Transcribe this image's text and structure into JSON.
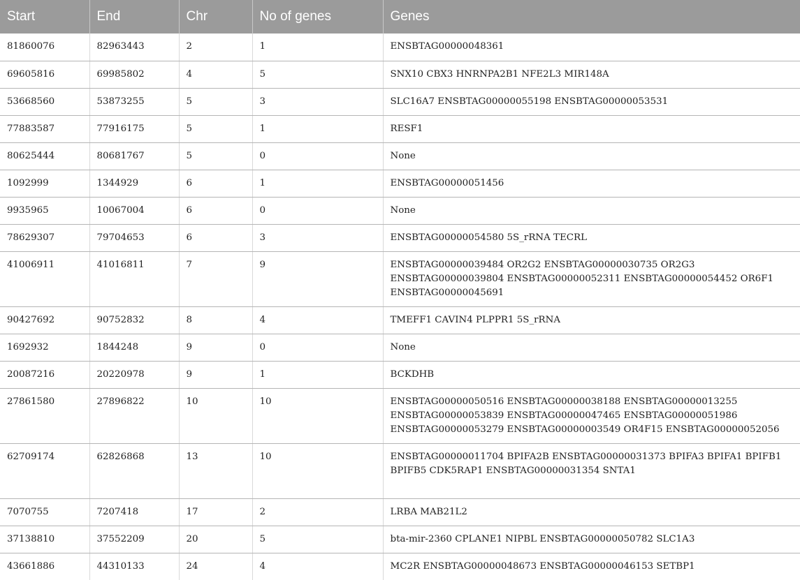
{
  "headers": [
    "Start",
    "End",
    "Chr",
    "No of genes",
    "Genes"
  ],
  "rows": [
    {
      "start": "81860076",
      "end": "82963443",
      "chr": "2",
      "count": "1",
      "genes": "ENSBTAG00000048361"
    },
    {
      "start": "69605816",
      "end": "69985802",
      "chr": "4",
      "count": "5",
      "genes": "SNX10 CBX3 HNRNPA2B1 NFE2L3 MIR148A"
    },
    {
      "start": "53668560",
      "end": "53873255",
      "chr": "5",
      "count": "3",
      "genes": "SLC16A7 ENSBTAG00000055198 ENSBTAG00000053531"
    },
    {
      "start": "77883587",
      "end": "77916175",
      "chr": "5",
      "count": "1",
      "genes": "RESF1"
    },
    {
      "start": "80625444",
      "end": "80681767",
      "chr": "5",
      "count": "0",
      "genes": "None"
    },
    {
      "start": "1092999",
      "end": "1344929",
      "chr": "6",
      "count": "1",
      "genes": "ENSBTAG00000051456"
    },
    {
      "start": "9935965",
      "end": "10067004",
      "chr": "6",
      "count": "0",
      "genes": "None"
    },
    {
      "start": "78629307",
      "end": "79704653",
      "chr": "6",
      "count": "3",
      "genes": "ENSBTAG00000054580 5S_rRNA TECRL"
    },
    {
      "start": "41006911",
      "end": "41016811",
      "chr": "7",
      "count": "9",
      "genes": "ENSBTAG00000039484 OR2G2 ENSBTAG00000030735 OR2G3 ENSBTAG00000039804 ENSBTAG00000052311 ENSBTAG00000054452 OR6F1 ENSBTAG00000045691"
    },
    {
      "start": "90427692",
      "end": "90752832",
      "chr": "8",
      "count": "4",
      "genes": "TMEFF1 CAVIN4 PLPPR1 5S_rRNA"
    },
    {
      "start": "1692932",
      "end": "1844248",
      "chr": "9",
      "count": "0",
      "genes": "None"
    },
    {
      "start": "20087216",
      "end": "20220978",
      "chr": "9",
      "count": "1",
      "genes": "BCKDHB"
    },
    {
      "start": "27861580",
      "end": "27896822",
      "chr": "10",
      "count": "10",
      "genes": "ENSBTAG00000050516 ENSBTAG00000038188 ENSBTAG00000013255 ENSBTAG00000053839 ENSBTAG00000047465 ENSBTAG00000051986 ENSBTAG00000053279 ENSBTAG00000003549 OR4F15 ENSBTAG00000052056"
    },
    {
      "start": "62709174",
      "end": "62826868",
      "chr": "13",
      "count": "10",
      "genes": "ENSBTAG00000011704 BPIFA2B ENSBTAG00000031373 BPIFA3 BPIFA1 BPIFB1 BPIFB5 CDK5RAP1 ENSBTAG00000031354 SNTA1"
    },
    {
      "start": "7070755",
      "end": "7207418",
      "chr": "17",
      "count": "2",
      "genes": "LRBA MAB21L2"
    },
    {
      "start": "37138810",
      "end": "37552209",
      "chr": "20",
      "count": "5",
      "genes": "bta-mir-2360 CPLANE1 NIPBL ENSBTAG00000050782 SLC1A3"
    },
    {
      "start": "43661886",
      "end": "44310133",
      "chr": "24",
      "count": "4",
      "genes": "MC2R ENSBTAG00000048673 ENSBTAG00000046153 SETBP1"
    }
  ]
}
